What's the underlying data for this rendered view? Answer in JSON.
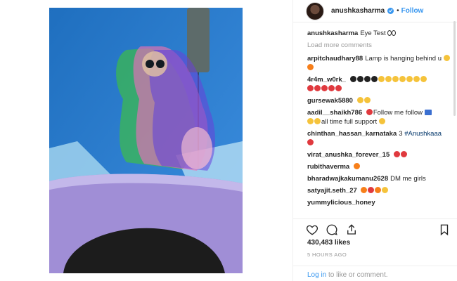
{
  "post": {
    "username": "anushkasharma",
    "follow_label": "Follow",
    "dot": "•"
  },
  "caption": {
    "username": "anushkasharma",
    "text": "Eye Test"
  },
  "load_more": "Load more comments",
  "comments": [
    {
      "username": "arpitchaudhary88",
      "text": "Lamp is hanging behind u"
    },
    {
      "username": "4r4m_w0rk_",
      "text": ""
    },
    {
      "username": "gursewak5880",
      "text": ""
    },
    {
      "username": "aadil__shaikh786",
      "text": "Follow me follow"
    },
    {
      "username": "",
      "text": "all time full support"
    },
    {
      "username": "chinthan_hassan_karnataka",
      "text": "3"
    },
    {
      "username": "virat_anushka_forever_15",
      "text": ""
    },
    {
      "username": "rubithaverma",
      "text": ""
    },
    {
      "username": "bharadwajkakumanu2628",
      "text": "DM me girls"
    },
    {
      "username": "satyajit.seth_27",
      "text": ""
    },
    {
      "username": "yummylicious_honey",
      "text": ""
    }
  ],
  "hashtag": "#Anushkaaa",
  "likes": "430,483 likes",
  "timestamp": "5 HOURS AGO",
  "login": {
    "link": "Log in",
    "text": "to like or comment."
  },
  "icons": {
    "like": "heart-icon",
    "comment": "comment-icon",
    "share": "share-icon",
    "save": "bookmark-icon"
  },
  "colors": {
    "link_blue": "#3897f0",
    "hashtag": "#003569",
    "muted": "#999999"
  }
}
